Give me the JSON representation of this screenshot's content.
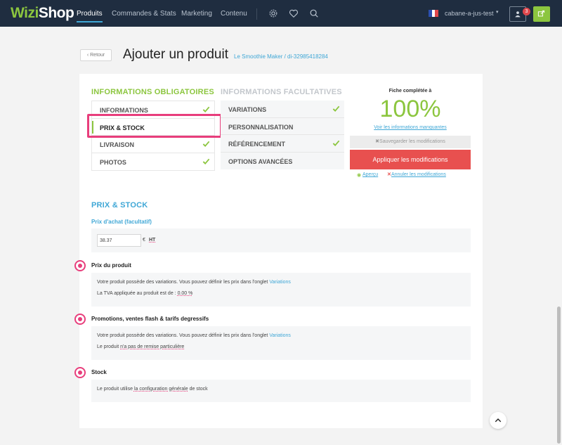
{
  "nav": {
    "logo_part1": "Wizi",
    "logo_part2": "Shop",
    "items": [
      "Produits",
      "Commandes & Stats",
      "Marketing",
      "Contenu"
    ],
    "shop_name": "cabane-a-jus-test",
    "notification_count": "3",
    "colors": {
      "bar": "#1f2d40",
      "accent": "#8cc63f",
      "active_underline": "#3fa7d6"
    }
  },
  "header": {
    "back_label": "‹ Retour",
    "title": "Ajouter un produit",
    "product_ref": "Le Smoothie Maker / di-32985418284"
  },
  "tabs": {
    "required_heading": "INFORMATIONS OBLIGATOIRES",
    "optional_heading": "INFORMATIONS FACULTATIVES",
    "required": [
      {
        "label": "INFORMATIONS",
        "checked": true
      },
      {
        "label": "PRIX & STOCK",
        "checked": false,
        "active": true
      },
      {
        "label": "LIVRAISON",
        "checked": true
      },
      {
        "label": "PHOTOS",
        "checked": true
      }
    ],
    "optional": [
      {
        "label": "VARIATIONS",
        "checked": true
      },
      {
        "label": "PERSONNALISATION",
        "checked": false
      },
      {
        "label": "RÉFÉRENCEMENT",
        "checked": true
      },
      {
        "label": "OPTIONS AVANCÉES",
        "checked": false
      }
    ]
  },
  "completion": {
    "label": "Fiche complétée à",
    "percent": "100%",
    "missing_link": "Voir les informations manquantes",
    "save_label": "Sauvegarder les modifications",
    "apply_label": "Appliquer les modifications",
    "preview_label": "Aperçu",
    "cancel_label": "Annuler les modifications"
  },
  "section": {
    "title": "PRIX & STOCK",
    "purchase_label": "Prix d'achat (facultatif)",
    "purchase_value": "38.37",
    "currency": "€",
    "tax_suffix": "HT",
    "price": {
      "heading": "Prix du produit",
      "line1_text": "Votre produit possède des variations. Vous pouvez définir les prix dans l'onglet",
      "line1_link": "Variations",
      "line2_text": "La TVA appliquée au produit est de :",
      "line2_value": "0.00 %"
    },
    "promotions": {
      "heading": "Promotions, ventes flash & tarifs degressifs",
      "line1_text": "Votre produit possède des variations. Vous pouvez définir les prix dans l'onglet",
      "line1_link": "Variations",
      "line2_pre": "Le produit",
      "line2_value": "n'a pas de remise particulière"
    },
    "stock": {
      "heading": "Stock",
      "line_pre": "Le produit utilise",
      "line_value": "la configuration générale",
      "line_post": "de stock"
    }
  }
}
